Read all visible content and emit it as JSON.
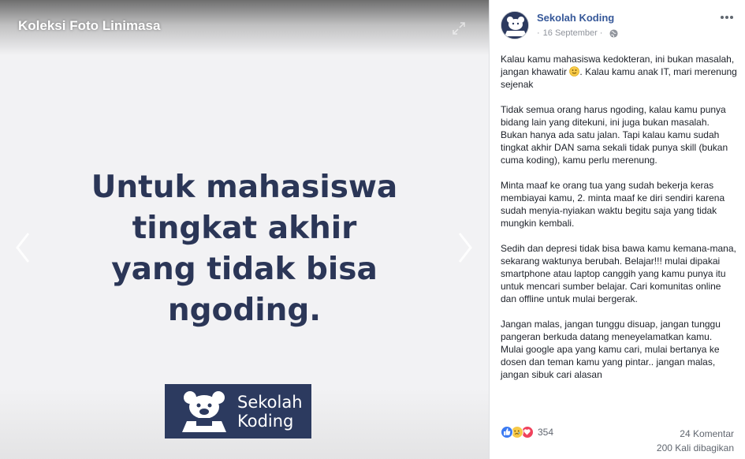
{
  "viewer": {
    "title": "Koleksi Foto Linimasa",
    "headline": [
      "Untuk mahasiswa",
      "tingkat akhir",
      "yang tidak bisa",
      "ngoding."
    ],
    "logo_lines": [
      "Sekolah",
      "Koding"
    ],
    "colors": {
      "headline": "#2b3657",
      "logo_bg": "#2c3a5f"
    }
  },
  "post": {
    "page_name": "Sekolah Koding",
    "date": "16 September",
    "paragraphs": [
      "Kalau kamu mahasiswa kedokteran, ini bukan masalah, jangan khawatir",
      "Tidak semua orang harus ngoding, kalau kamu punya bidang lain yang ditekuni, ini juga bukan masalah. Bukan hanya ada satu jalan. Tapi kalau kamu sudah tingkat akhir DAN sama sekali tidak punya skill (bukan cuma koding), kamu perlu merenung.",
      "Minta maaf ke orang tua yang sudah bekerja keras membiayai kamu, 2. minta maaf ke diri sendiri karena sudah menyia-nyiakan waktu begitu saja yang tidak mungkin kembali.",
      "Sedih dan depresi tidak bisa bawa kamu kemana-mana, sekarang waktunya berubah. Belajar!!! mulai dipakai smartphone atau laptop canggih yang kamu punya itu untuk mencari sumber belajar. Cari komunitas online dan offline untuk mulai bergerak.",
      "Jangan malas, jangan tunggu disuap, jangan tunggu pangeran berkuda datang meneyelamatkan kamu. Mulai google apa yang kamu cari, mulai bertanya ke dosen dan teman kamu yang pintar.. jangan malas, jangan sibuk cari alasan"
    ],
    "para1_tail": ". Kalau kamu anak IT, mari merenung sejenak",
    "reaction_count": "354",
    "comments": "24 Komentar",
    "shares": "200 Kali dibagikan",
    "icons": [
      "expand-icon",
      "chevron-left-icon",
      "chevron-right-icon",
      "globe-icon",
      "more-icon",
      "smile-emoji-icon",
      "like-reaction-icon",
      "sad-reaction-icon",
      "love-reaction-icon"
    ],
    "colors": {
      "link": "#365899",
      "meta": "#90949c",
      "text": "#1d2129"
    }
  }
}
